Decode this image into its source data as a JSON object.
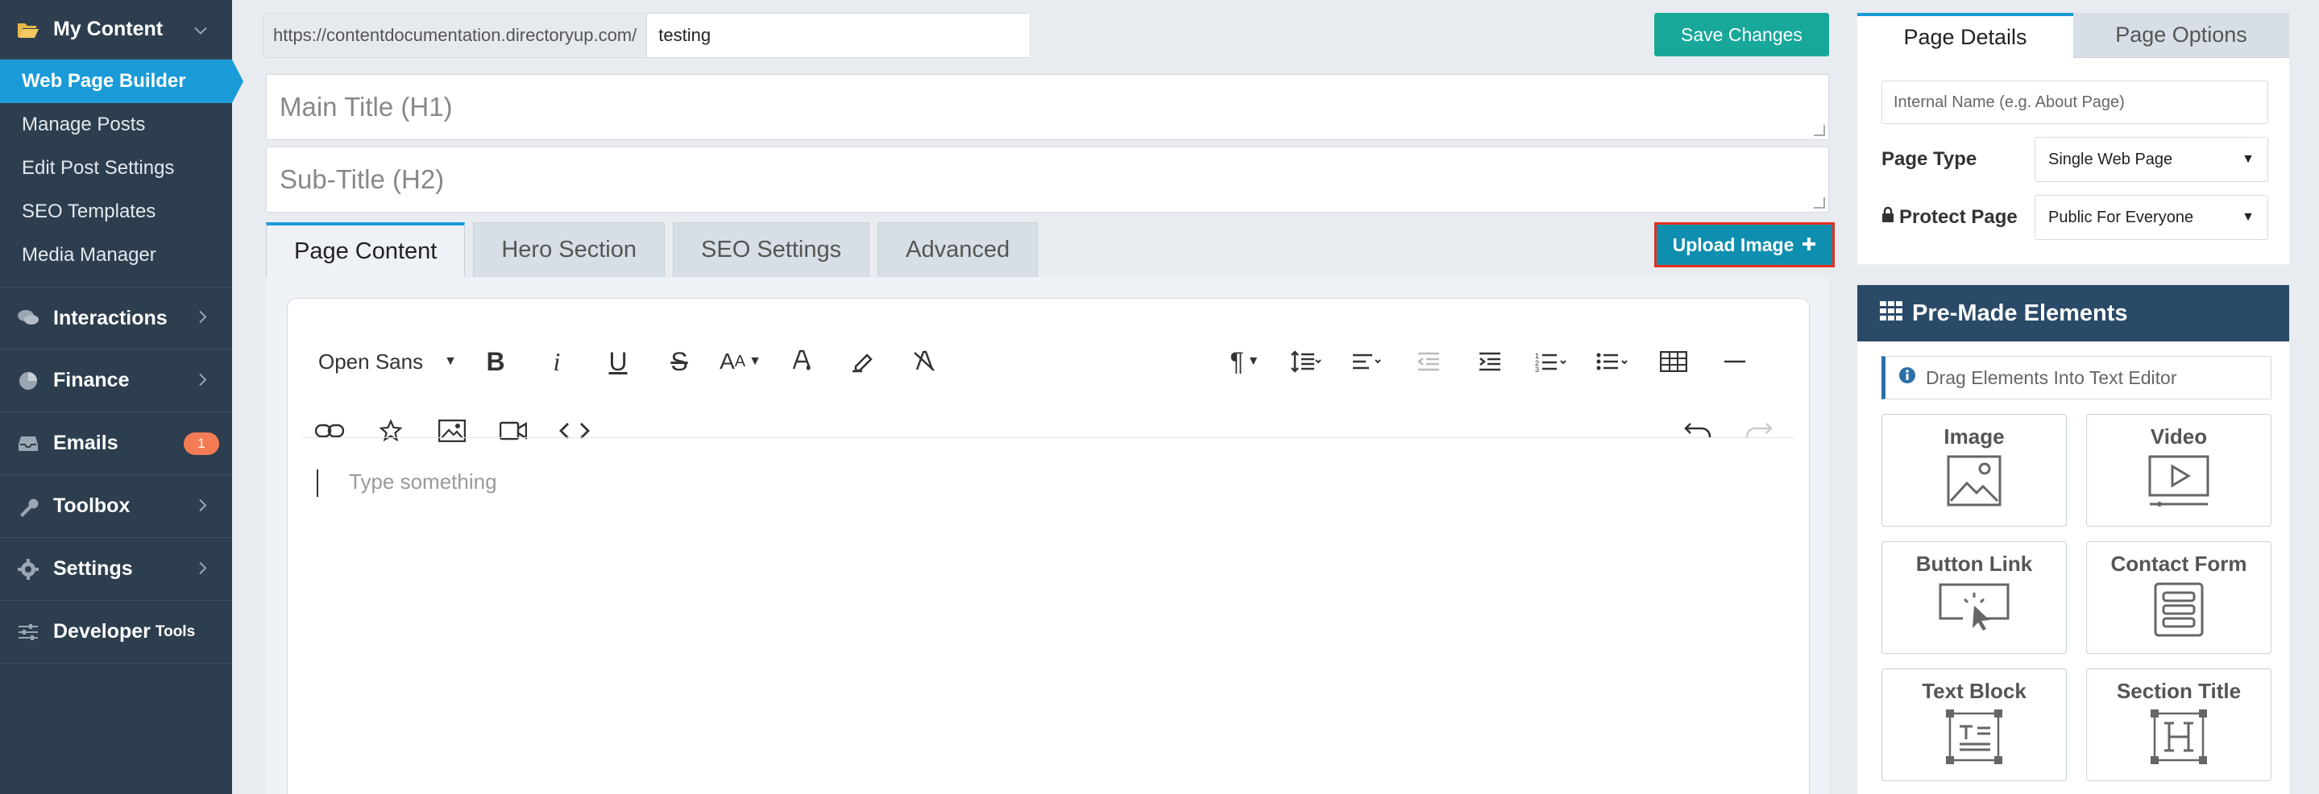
{
  "sidebar": {
    "my_content": "My Content",
    "sub_items": [
      "Web Page Builder",
      "Manage Posts",
      "Edit Post Settings",
      "SEO Templates",
      "Media Manager"
    ],
    "interactions": "Interactions",
    "finance": "Finance",
    "emails": "Emails",
    "emails_badge": "1",
    "toolbox": "Toolbox",
    "settings": "Settings",
    "developer": "Developer",
    "developer_suffix": "Tools"
  },
  "url": {
    "prefix": "https://contentdocumentation.directoryup.com/",
    "value": "testing"
  },
  "save_label": "Save Changes",
  "main_title_placeholder": "Main Title (H1)",
  "sub_title_placeholder": "Sub-Title (H2)",
  "tabs": [
    "Page Content",
    "Hero Section",
    "SEO Settings",
    "Advanced"
  ],
  "upload_label": "Upload Image",
  "editor": {
    "font": "Open Sans",
    "placeholder": "Type something"
  },
  "right_panel": {
    "tabs": [
      "Page Details",
      "Page Options"
    ],
    "internal_name_placeholder": "Internal Name (e.g. About Page)",
    "page_type_label": "Page Type",
    "page_type_value": "Single Web Page",
    "protect_label": "Protect Page",
    "protect_value": "Public For Everyone"
  },
  "premade": {
    "title": "Pre-Made Elements",
    "hint": "Drag Elements Into Text Editor",
    "cards": [
      "Image",
      "Video",
      "Button Link",
      "Contact Form",
      "Text Block",
      "Section Title"
    ]
  },
  "colors": {
    "sidebar_bg": "#2d3e4e",
    "active_blue": "#1a9bd7",
    "save_green": "#17a89a",
    "upload_teal": "#0f8fb0",
    "highlight_red": "#e4301f",
    "premade_header": "#2a4a68"
  }
}
